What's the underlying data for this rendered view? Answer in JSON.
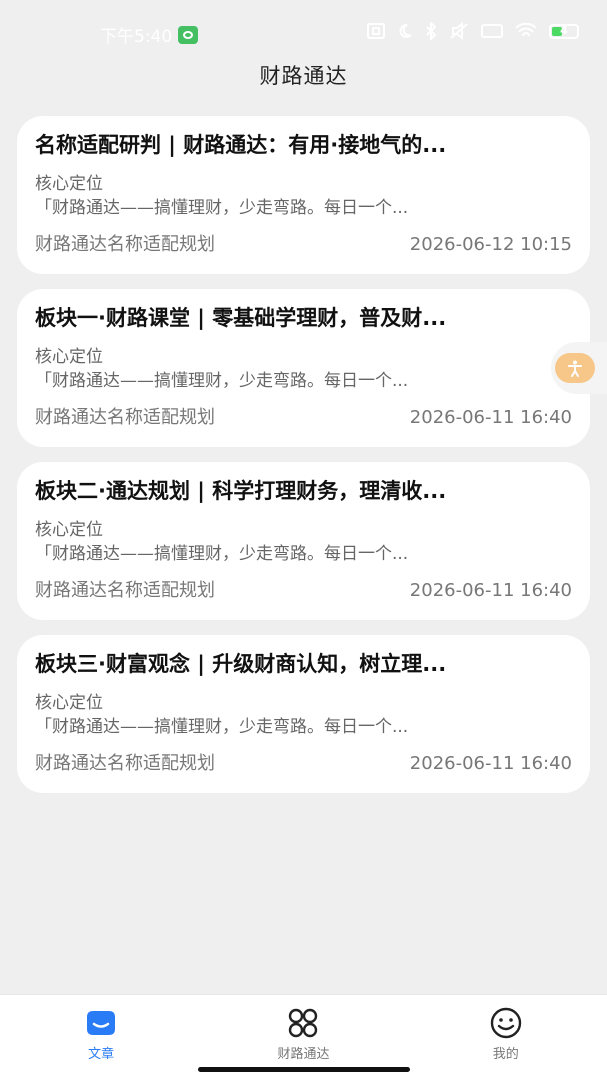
{
  "status_bar": {
    "time": "下午5:40",
    "battery": "4"
  },
  "header": {
    "title": "财路通达"
  },
  "articles": [
    {
      "title": "名称适配研判 | 财路通达：有用·接地气的...",
      "label": "核心定位",
      "excerpt": "「财路通达——搞懂理财，少走弯路。每日一个...",
      "source": "财路通达名称适配规划",
      "date": "2026-06-12 10:15"
    },
    {
      "title": "板块一·财路课堂 | 零基础学理财，普及财...",
      "label": "核心定位",
      "excerpt": "「财路通达——搞懂理财，少走弯路。每日一个...",
      "source": "财路通达名称适配规划",
      "date": "2026-06-11 16:40"
    },
    {
      "title": "板块二·通达规划 | 科学打理财务，理清收...",
      "label": "核心定位",
      "excerpt": "「财路通达——搞懂理财，少走弯路。每日一个...",
      "source": "财路通达名称适配规划",
      "date": "2026-06-11 16:40"
    },
    {
      "title": "板块三·财富观念 | 升级财商认知，树立理...",
      "label": "核心定位",
      "excerpt": "「财路通达——搞懂理财，少走弯路。每日一个...",
      "source": "财路通达名称适配规划",
      "date": "2026-06-11 16:40"
    }
  ],
  "tabs": [
    {
      "label": "文章",
      "icon": "article-icon",
      "active": true
    },
    {
      "label": "财路通达",
      "icon": "grid-icon",
      "active": false
    },
    {
      "label": "我的",
      "icon": "smile-icon",
      "active": false
    }
  ],
  "colors": {
    "accent": "#2a7cf6",
    "background": "#efefef",
    "card": "#ffffff",
    "float_button": "#f7c78a"
  }
}
